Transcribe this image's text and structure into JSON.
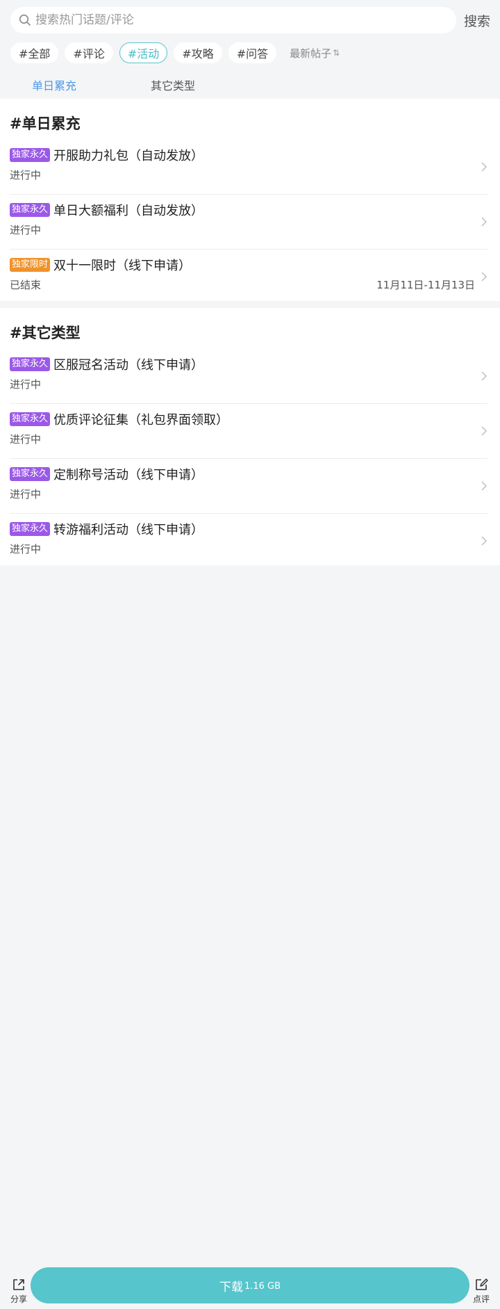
{
  "search": {
    "placeholder": "搜索热门话题/评论",
    "button_label": "搜索"
  },
  "tags": [
    {
      "label": "#全部",
      "active": false
    },
    {
      "label": "#评论",
      "active": false
    },
    {
      "label": "#活动",
      "active": true
    },
    {
      "label": "#攻略",
      "active": false
    },
    {
      "label": "#问答",
      "active": false
    }
  ],
  "sort": {
    "label": "最新帖子",
    "icon": "sort-arrows-icon"
  },
  "subtabs": [
    {
      "label": "单日累充",
      "active": true
    },
    {
      "label": "其它类型",
      "active": false
    }
  ],
  "colors": {
    "accent": "#56c5cc",
    "tab_active": "#4a9ae8",
    "badge_permanent": "#9b59e8",
    "badge_limited": "#f0922b"
  },
  "sections": [
    {
      "title": "#单日累充",
      "items": [
        {
          "badge": "独家永久",
          "badge_type": "permanent",
          "name": "开服助力礼包（自动发放）",
          "status": "进行中",
          "date": ""
        },
        {
          "badge": "独家永久",
          "badge_type": "permanent",
          "name": "单日大额福利（自动发放）",
          "status": "进行中",
          "date": ""
        },
        {
          "badge": "独家限时",
          "badge_type": "limited",
          "name": "双十一限时（线下申请）",
          "status": "已结束",
          "date": "11月11日-11月13日"
        }
      ]
    },
    {
      "title": "#其它类型",
      "items": [
        {
          "badge": "独家永久",
          "badge_type": "permanent",
          "name": "区服冠名活动（线下申请）",
          "status": "进行中",
          "date": ""
        },
        {
          "badge": "独家永久",
          "badge_type": "permanent",
          "name": "优质评论征集（礼包界面领取）",
          "status": "进行中",
          "date": ""
        },
        {
          "badge": "独家永久",
          "badge_type": "permanent",
          "name": "定制称号活动（线下申请）",
          "status": "进行中",
          "date": ""
        },
        {
          "badge": "独家永久",
          "badge_type": "permanent",
          "name": "转游福利活动（线下申请）",
          "status": "进行中",
          "date": ""
        }
      ]
    }
  ],
  "bottom": {
    "share_label": "分享",
    "download_label": "下载",
    "download_size": "1.16 GB",
    "review_label": "点评"
  }
}
